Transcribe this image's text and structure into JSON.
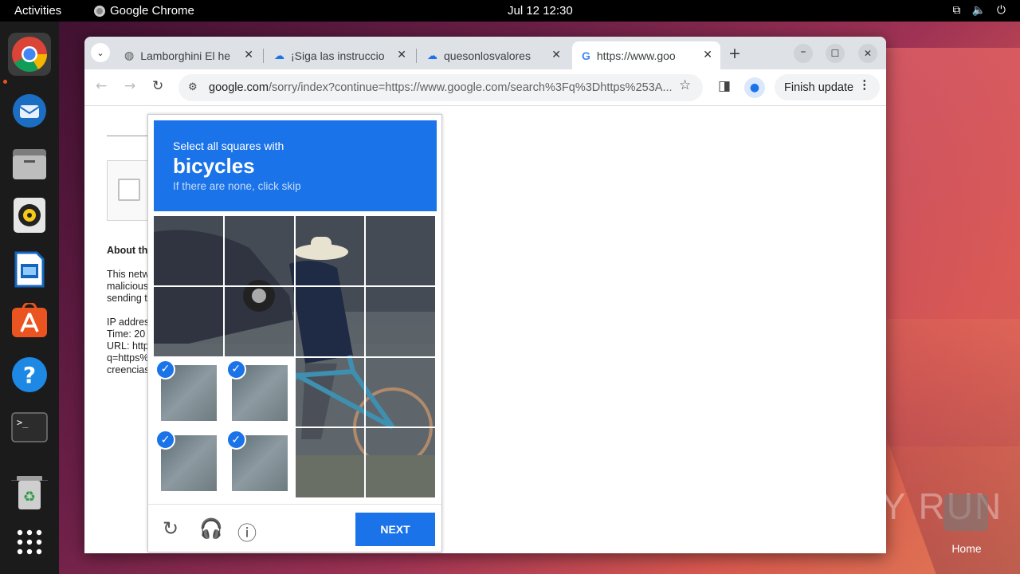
{
  "topbar": {
    "activities": "Activities",
    "app_name": "Google Chrome",
    "clock": "Jul 12  12:30"
  },
  "dock": {
    "items": [
      "chrome-icon",
      "thunderbird-icon",
      "files-icon",
      "rhythmbox-icon",
      "writer-icon",
      "app-center-icon",
      "help-icon",
      "terminal-icon",
      "trash-icon",
      "app-grid-icon"
    ]
  },
  "browser": {
    "tabs": [
      {
        "title": "Lamborghini El he",
        "active": false
      },
      {
        "title": "¡Siga las instruccio",
        "active": false
      },
      {
        "title": "quesonlosvalores",
        "active": false
      },
      {
        "title": "https://www.goo",
        "active": true
      }
    ],
    "url_host": "google.com",
    "url_path": "/sorry/index?continue=https://www.google.com/search%3Fq%3Dhttps%253A...",
    "finish_update": "Finish update"
  },
  "page": {
    "about": "About th",
    "para": [
      "This netw",
      "malicious",
      "sending t"
    ],
    "info": [
      "IP addres",
      "Time: 20",
      "URL: http",
      "q=https%",
      "creencias"
    ]
  },
  "captcha": {
    "instruction": "Select all squares with",
    "target": "bicycles",
    "hint": "If there are none, click skip",
    "next": "NEXT",
    "selected": [
      8,
      9,
      12,
      13
    ]
  },
  "desktop": {
    "watermark": "ANY RUN",
    "home_label": "Home"
  },
  "colors": {
    "accent": "#1a73e8",
    "ubuntu_orange": "#e95420"
  }
}
